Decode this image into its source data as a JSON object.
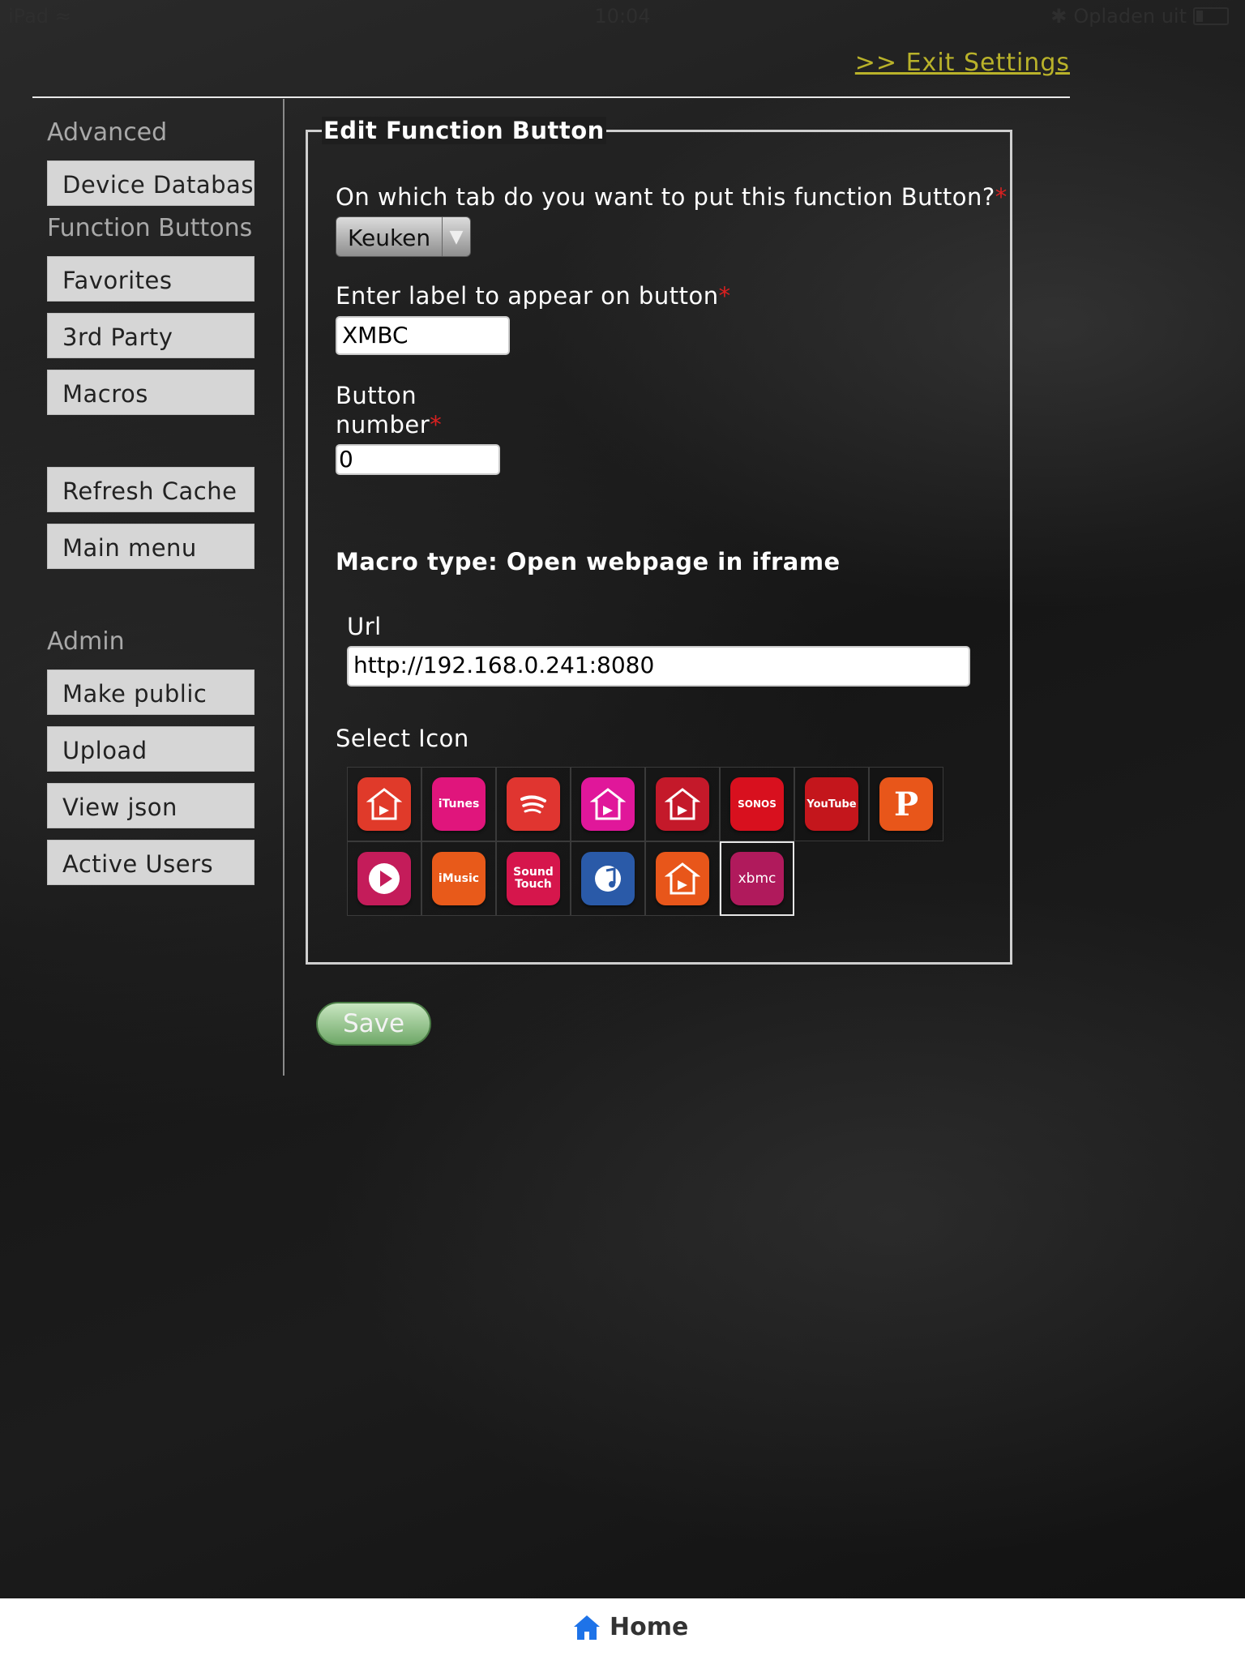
{
  "status_bar": {
    "device": "iPad",
    "time": "10:04",
    "charging": "Opladen uit"
  },
  "header": {
    "exit_link": ">> Exit Settings"
  },
  "sidebar": {
    "advanced_heading": "Advanced",
    "device_database": "Device Database",
    "function_buttons_heading": "Function Buttons",
    "favorites": "Favorites",
    "third_party": "3rd Party",
    "macros": "Macros",
    "refresh_cache": "Refresh Cache",
    "main_menu": "Main menu",
    "admin_heading": "Admin",
    "make_public": "Make public",
    "upload": "Upload",
    "view_json": "View json",
    "active_users": "Active Users"
  },
  "form": {
    "legend": "Edit Function Button",
    "tab_question": "On which tab do you want to put this function Button?",
    "tab_value": "Keuken",
    "label_question": "Enter label to appear on button",
    "label_value": "XMBC",
    "button_number_line1": "Button",
    "button_number_line2": "number",
    "button_number_value": "0",
    "required_mark": "*",
    "macro_type": "Macro type: Open webpage in iframe",
    "url_label": "Url",
    "url_value": "http://192.168.0.241:8080",
    "select_icon_label": "Select Icon",
    "save": "Save"
  },
  "icons": [
    {
      "name": "home-red-icon",
      "color": "#e03a2a",
      "text": ""
    },
    {
      "name": "itunes-icon",
      "color": "#e0157c",
      "text": "iTunes"
    },
    {
      "name": "spotify-icon",
      "color": "#e03530",
      "text": ""
    },
    {
      "name": "home-pink-icon",
      "color": "#e0179a",
      "text": ""
    },
    {
      "name": "home-darkred-icon",
      "color": "#c4192a",
      "text": ""
    },
    {
      "name": "sonos-icon",
      "color": "#d8101e",
      "text": "SONOS"
    },
    {
      "name": "youtube-icon",
      "color": "#c4161c",
      "text": "YouTube"
    },
    {
      "name": "pandora-icon",
      "color": "#e8561a",
      "text": "P"
    },
    {
      "name": "play-icon",
      "color": "#c41c5a",
      "text": ""
    },
    {
      "name": "imusic-icon",
      "color": "#e85a1a",
      "text": "iMusic"
    },
    {
      "name": "soundtouch-icon",
      "color": "#d6164c",
      "text": "Sound Touch"
    },
    {
      "name": "music-note-icon",
      "color": "#2a5aa8",
      "text": ""
    },
    {
      "name": "home-orange-icon",
      "color": "#e8561a",
      "text": ""
    },
    {
      "name": "xbmc-icon",
      "color": "#b01a5c",
      "text": "xbmc"
    }
  ],
  "bottom_bar": {
    "home": "Home"
  }
}
